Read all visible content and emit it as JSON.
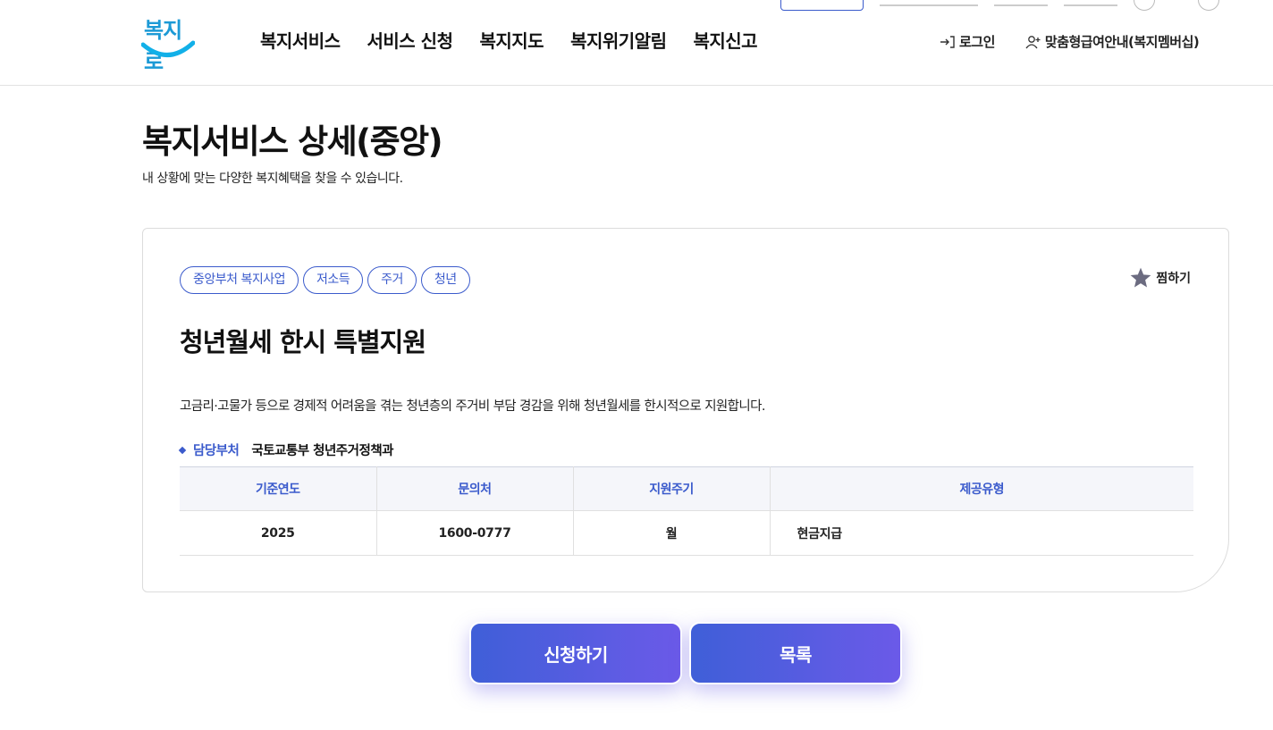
{
  "header": {
    "logo_text": "복지로",
    "nav": [
      "복지서비스",
      "서비스 신청",
      "복지지도",
      "복지위기알림",
      "복지신고"
    ],
    "login_label": "로그인",
    "membership_label": "맞춤형급여안내(복지멤버십)"
  },
  "page": {
    "title": "복지서비스 상세(중앙)",
    "subtitle": "내 상황에 맞는 다양한 복지혜택을 찾을 수 있습니다."
  },
  "service": {
    "tags": [
      "중앙부처 복지사업",
      "저소득",
      "주거",
      "청년"
    ],
    "favorite_label": "찜하기",
    "title": "청년월세 한시 특별지원",
    "description": "고금리·고물가 등으로 경제적 어려움을 겪는 청년층의 주거비 부담 경감을 위해 청년월세를 한시적으로 지원합니다.",
    "department_label": "담당부처",
    "department_value": "국토교통부 청년주거정책과",
    "table": {
      "headers": [
        "기준연도",
        "문의처",
        "지원주기",
        "제공유형"
      ],
      "row": [
        "2025",
        "1600-0777",
        "월",
        "현금지급"
      ]
    }
  },
  "actions": {
    "apply_label": "신청하기",
    "list_label": "목록"
  },
  "colors": {
    "accent": "#3b5bcc",
    "button_gradient_start": "#3f5fd8",
    "button_gradient_end": "#6b5ae8",
    "logo": "#1c9ad6"
  }
}
